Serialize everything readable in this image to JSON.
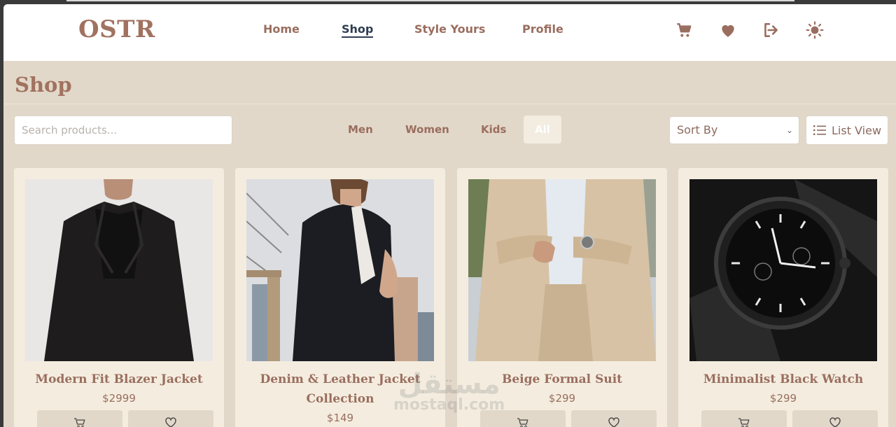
{
  "brand": {
    "logo": "OSTR"
  },
  "nav": {
    "links": [
      "Home",
      "Shop",
      "Style Yours",
      "Profile"
    ],
    "active": "Shop",
    "icons": [
      "cart-icon",
      "heart-icon",
      "logout-icon",
      "sun-icon"
    ]
  },
  "page": {
    "title": "Shop"
  },
  "filters": {
    "search_placeholder": "Search products...",
    "categories": [
      "Men",
      "Women",
      "Kids",
      "All"
    ],
    "active_category": "All",
    "sort_label": "Sort By",
    "view_label": "List View"
  },
  "products": [
    {
      "name": "Modern Fit Blazer Jacket",
      "price": "$2999"
    },
    {
      "name": "Denim & Leather Jacket Collection",
      "price": "$149"
    },
    {
      "name": "Beige Formal Suit",
      "price": "$299"
    },
    {
      "name": "Minimalist Black Watch",
      "price": "$299"
    }
  ],
  "watermark": {
    "arabic": "مستقل",
    "latin": "mostaql.com"
  },
  "colors": {
    "accent": "#9a6e5f",
    "background": "#e2d8c9",
    "card": "#f4eddf",
    "active_link": "#2f3e50"
  }
}
